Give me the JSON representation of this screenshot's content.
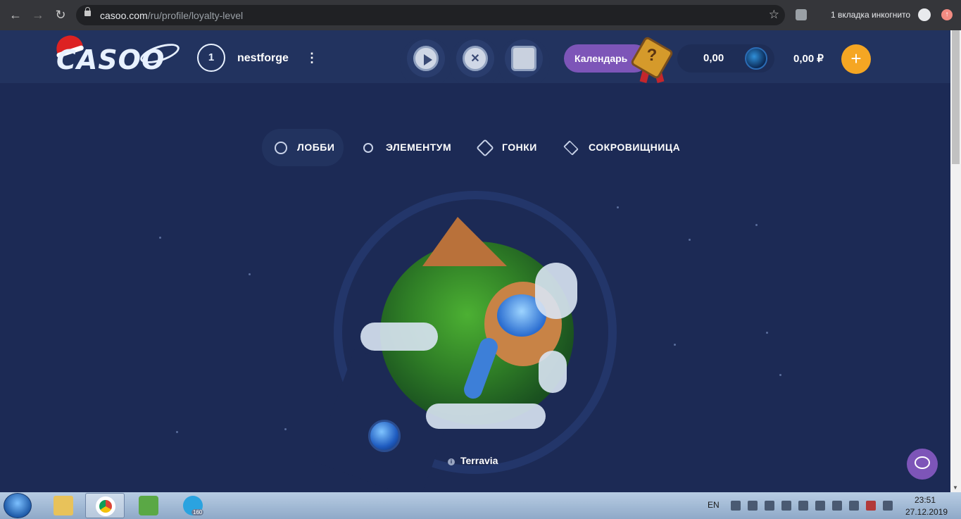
{
  "browser": {
    "url_host": "casoo.com",
    "url_path": "/ru/profile/loyalty-level",
    "incognito_label": "1 вкладка инкогнито"
  },
  "header": {
    "logo_text": "CASOO",
    "level": "1",
    "username": "nestforge",
    "calendar_label": "Календарь",
    "coin_balance": "0,00",
    "rub_balance": "0,00 ₽",
    "add_label": "+"
  },
  "tabs": [
    {
      "label": "ЛОББИ",
      "active": true
    },
    {
      "label": "ЭЛЕМЕНТУМ",
      "active": false
    },
    {
      "label": "ГОНКИ",
      "active": false
    },
    {
      "label": "СОКРОВИЩНИЦА",
      "active": false
    }
  ],
  "planet": {
    "name": "Terravia",
    "info_glyph": "i"
  },
  "taskbar": {
    "lang": "EN",
    "time": "23:51",
    "date": "27.12.2019",
    "telegram_badge": "160"
  }
}
